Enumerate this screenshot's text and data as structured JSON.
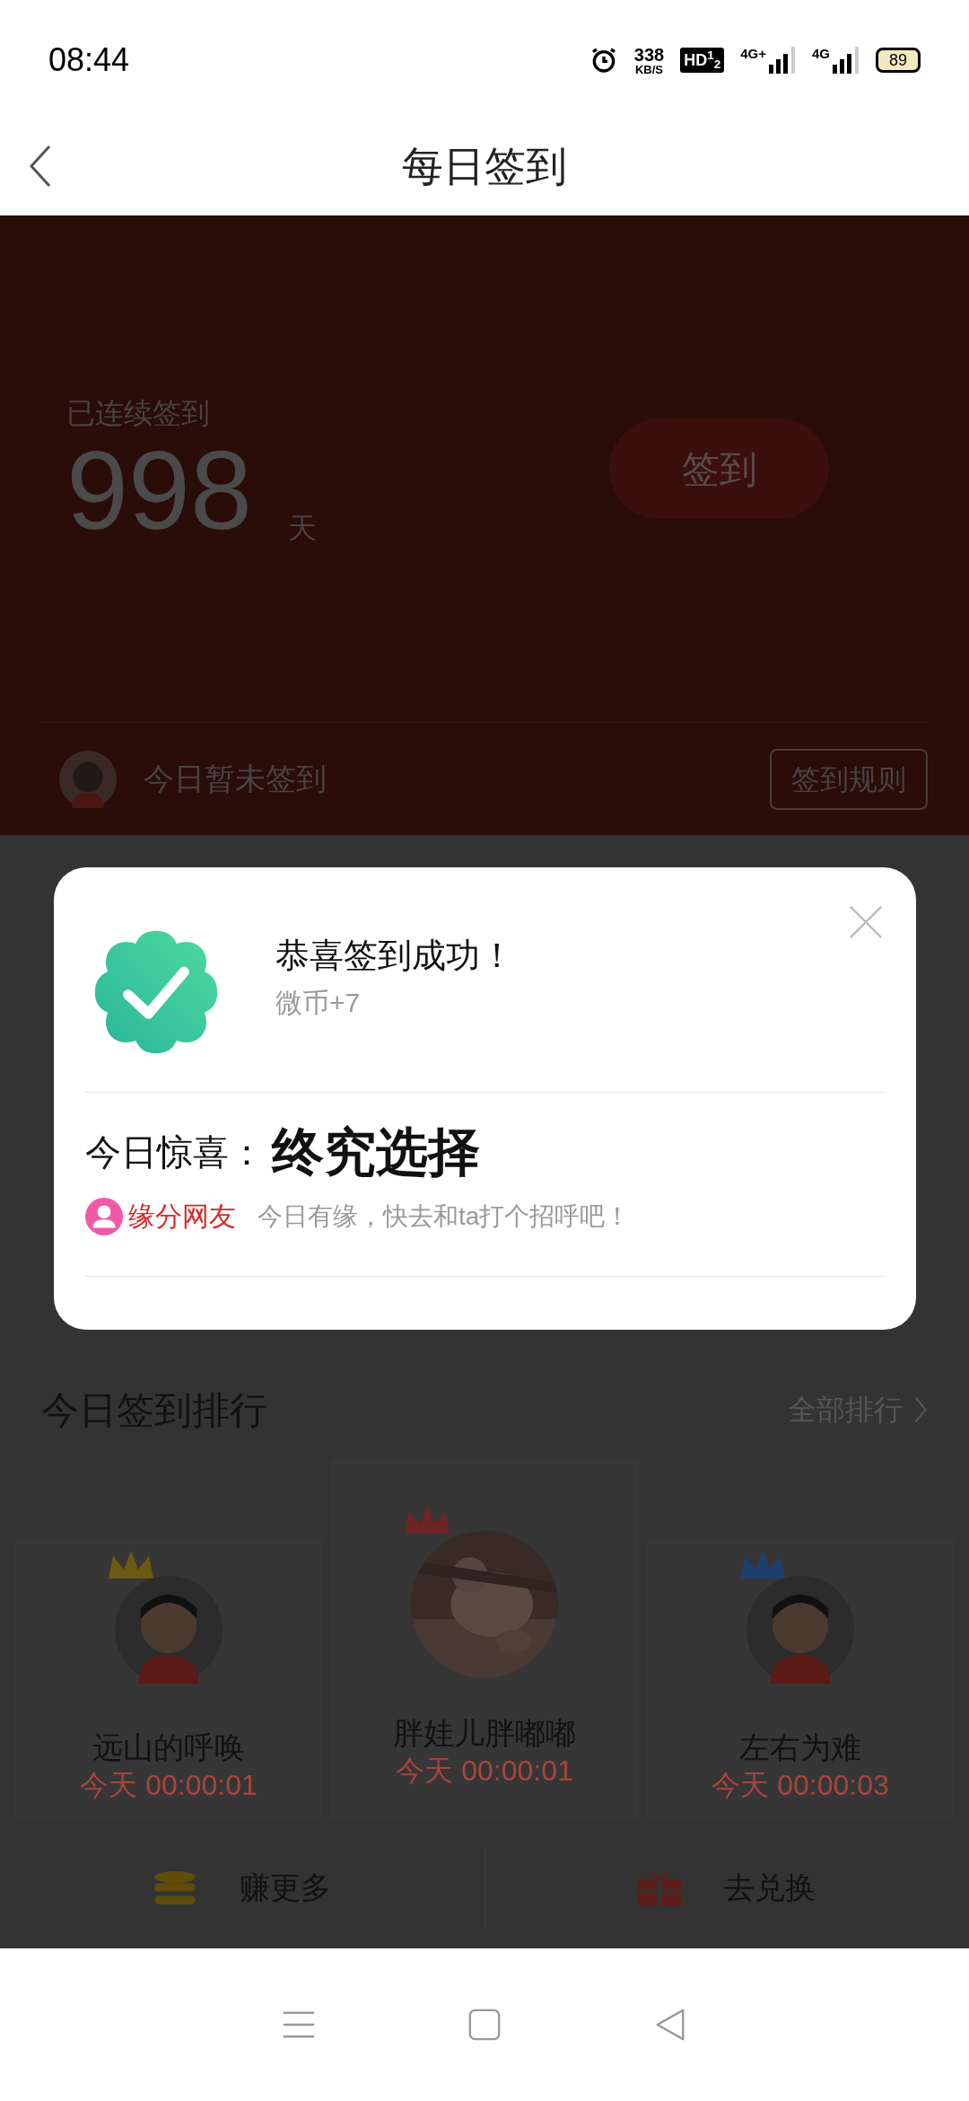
{
  "status_bar": {
    "time": "08:44",
    "net_speed": "338",
    "net_speed_unit": "KB/S",
    "hd": "HD$^{1}$$_{2}$",
    "signals": [
      {
        "label": "4G+"
      },
      {
        "label": "4G"
      }
    ],
    "battery": "89"
  },
  "header": {
    "title": "每日签到"
  },
  "hero": {
    "streak_label": "已连续签到",
    "streak_days": "998",
    "unit": "天",
    "checkin_button": "签到",
    "status": "今日暂未签到",
    "rules_button": "签到规则"
  },
  "ranking": {
    "title": "今日签到排行",
    "all_link": "全部排行",
    "users": [
      {
        "name": "远山的呼唤",
        "time": "今天 00:00:01",
        "color": "#6b5a10",
        "kind": "cartoon",
        "top": false
      },
      {
        "name": "胖娃儿胖嘟嘟",
        "time": "今天 00:00:01",
        "color": "#6e2424",
        "top": true
      },
      {
        "name": "左右为难",
        "time": "今天 00:00:03",
        "color": "#1d3f6e",
        "kind": "cartoon",
        "top": false
      }
    ]
  },
  "actions": [
    {
      "label": "赚更多",
      "kind": "coins"
    },
    {
      "label": "去兑换",
      "kind": "gift"
    }
  ],
  "dialog": {
    "title": "恭喜签到成功！",
    "reward": "微币+7",
    "surprise_label": "今日惊喜：",
    "surprise_value": "终究选择",
    "tag": "缘分网友",
    "message": "今日有缘，快去和ta打个招呼吧！"
  }
}
